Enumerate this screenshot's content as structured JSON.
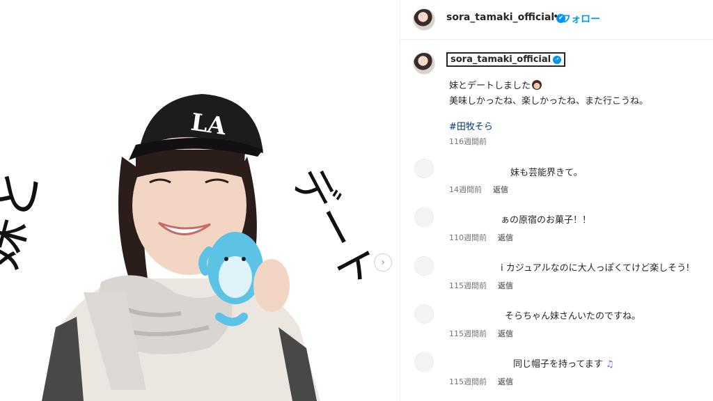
{
  "media": {
    "handwriting_left": "妹と",
    "handwriting_right": "デート",
    "cap_logo": "LA",
    "next_icon": "chevron-right-icon",
    "colors": {
      "cap": "#1c1c1e",
      "scarf": "#d9d6d2",
      "plush": "#5cc2e6",
      "sweater": "#ebe7e0"
    }
  },
  "header": {
    "username": "sora_tamaki_official",
    "verified_icon": "✔",
    "dot": "•",
    "follow_label": "フォロー"
  },
  "caption": {
    "username": "sora_tamaki_official",
    "verified_icon": "✔",
    "dot": ".",
    "line1": "妹とデートしました",
    "line2": "美味しかったね、楽しかったね、また行こうね。",
    "hashtag": "#田牧そら",
    "time": "116週間前"
  },
  "comments": [
    {
      "text": "妹も芸能界きて。",
      "time": "14週間前",
      "reply": "返信"
    },
    {
      "text": "ぁの原宿のお菓子！！",
      "time": "110週間前",
      "reply": "返信"
    },
    {
      "text": "i カジュアルなのに大人っぽくてけど楽しそう!",
      "time": "115週間前",
      "reply": "返信"
    },
    {
      "text": "そらちゃん妹さんいたのですね。",
      "time": "115週間前",
      "reply": "返信"
    },
    {
      "text": "同じ帽子を持ってます",
      "note": "♫",
      "time": "115週間前",
      "reply": "返信"
    }
  ],
  "accent": "#0095f6"
}
